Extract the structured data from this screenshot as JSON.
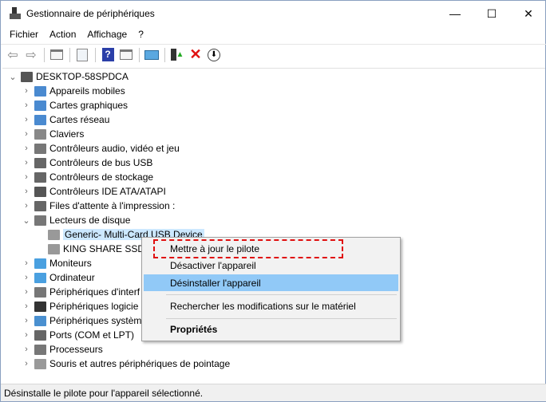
{
  "window": {
    "title": "Gestionnaire de périphériques",
    "minimize": "—",
    "maximize": "☐",
    "close": "✕"
  },
  "menu": [
    "Fichier",
    "Action",
    "Affichage",
    "?"
  ],
  "toolbar": [
    "back-icon",
    "forward-icon",
    "show-hide-console-tree-icon",
    "properties-icon",
    "help-icon",
    "action-pane-icon",
    "scan-hardware-icon",
    "update-driver-icon",
    "uninstall-icon",
    "disable-device-icon"
  ],
  "tree": {
    "root": "DESKTOP-58SPDCA",
    "categories": [
      "Appareils mobiles",
      "Cartes graphiques",
      "Cartes réseau",
      "Claviers",
      "Contrôleurs audio, vidéo et jeu",
      "Contrôleurs de bus USB",
      "Contrôleurs de stockage",
      "Contrôleurs IDE ATA/ATAPI",
      "Files d'attente à l'impression :",
      "Lecteurs de disque"
    ],
    "disks": [
      "Generic- Multi-Card USB Device",
      "KING SHARE SSD"
    ],
    "after": [
      "Moniteurs",
      "Ordinateur",
      "Périphériques d'interf",
      "Périphériques logicie",
      "Périphériques systèm",
      "Ports (COM et LPT)",
      "Processeurs",
      "Souris et autres périphériques de pointage"
    ]
  },
  "context_menu": {
    "update": "Mettre à jour le pilote",
    "disable": "Désactiver l'appareil",
    "uninstall": "Désinstaller l'appareil",
    "scan": "Rechercher les modifications sur le matériel",
    "properties": "Propriétés"
  },
  "status": "Désinstalle le pilote pour l'appareil sélectionné.",
  "colors": {
    "selection": "#cce8ff",
    "highlight": "#91c9f7",
    "annotation": "#e01010"
  }
}
